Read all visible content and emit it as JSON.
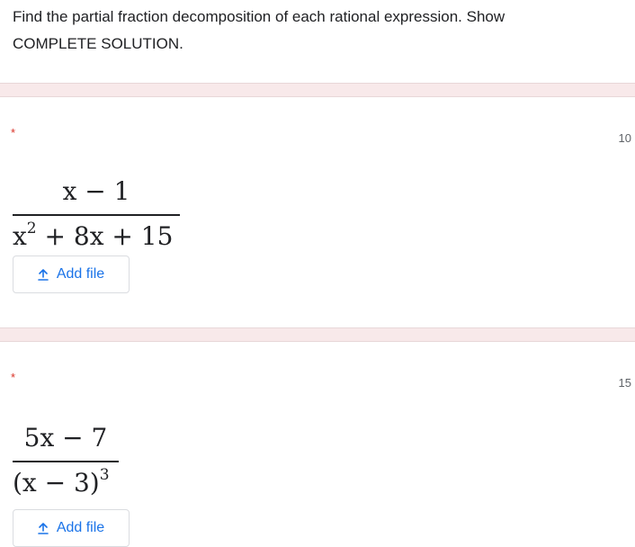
{
  "instructions": {
    "line1": "Find the partial fraction decomposition of each rational expression. Show",
    "line2": "COMPLETE SOLUTION."
  },
  "questions": [
    {
      "required_marker": "*",
      "points": "10",
      "numerator": "x − 1",
      "denominator_base": "x",
      "denominator_exponent": "2",
      "denominator_rest": " + 8x + 15",
      "add_file_label": "Add file"
    },
    {
      "required_marker": "*",
      "points": "15",
      "numerator": "5x − 7",
      "denominator_base": "(x − 3)",
      "denominator_exponent": "3",
      "denominator_rest": "",
      "add_file_label": "Add file"
    }
  ],
  "icons": {
    "upload": "upload-icon"
  },
  "colors": {
    "accent": "#1a73e8",
    "required": "#d93025",
    "separator": "#f8e9ea",
    "text": "#202124"
  }
}
